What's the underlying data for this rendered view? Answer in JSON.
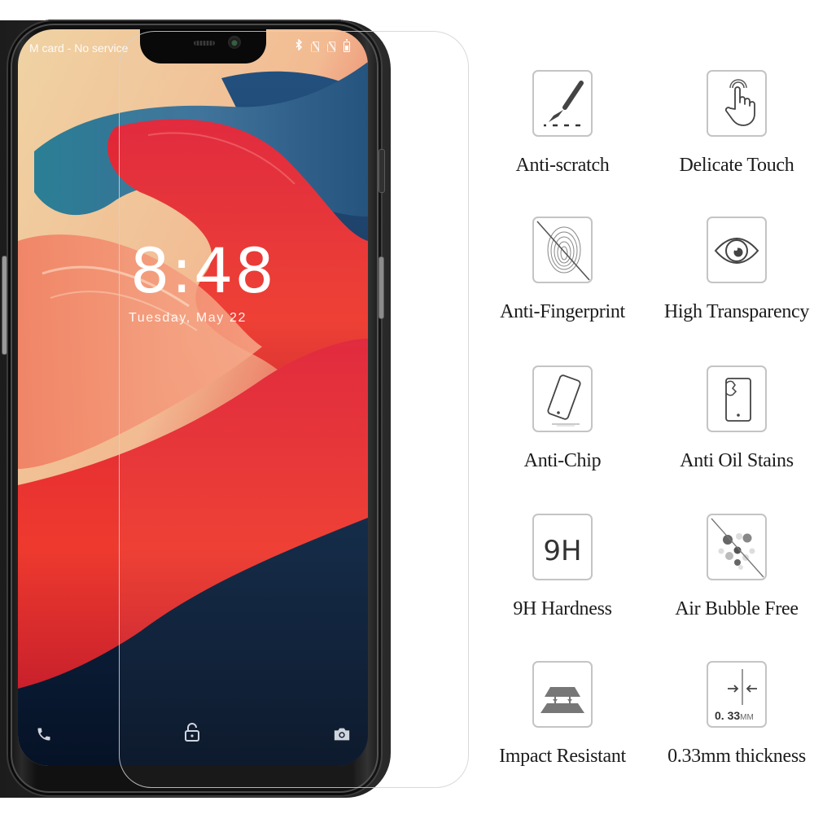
{
  "phone": {
    "status_bar": {
      "carrier_text": "M card - No service",
      "icons": [
        "bluetooth-icon",
        "no-sim-icon",
        "no-sim-icon",
        "battery-icon"
      ]
    },
    "lock_screen": {
      "time": "8:48",
      "date": "Tuesday, May 22"
    },
    "bottom_shortcuts": [
      "phone-icon",
      "unlock-icon",
      "camera-icon"
    ]
  },
  "features": [
    {
      "label": "Anti-scratch",
      "icon": "scalpel-icon"
    },
    {
      "label": "Delicate Touch",
      "icon": "touch-hand-icon"
    },
    {
      "label": "Anti-Fingerprint",
      "icon": "no-fingerprint-icon"
    },
    {
      "label": "High Transparency",
      "icon": "eye-icon"
    },
    {
      "label": "Anti-Chip",
      "icon": "tilted-phone-icon"
    },
    {
      "label": "Anti Oil Stains",
      "icon": "phone-stain-icon"
    },
    {
      "label": "9H Hardness",
      "icon": "9h-icon",
      "icon_text": "9H"
    },
    {
      "label": "Air Bubble Free",
      "icon": "no-bubbles-icon"
    },
    {
      "label": "Impact Resistant",
      "icon": "layers-icon"
    },
    {
      "label": "0.33mm thickness",
      "icon": "thickness-icon",
      "icon_text_value": "0. 33",
      "icon_text_unit": "MM"
    }
  ]
}
